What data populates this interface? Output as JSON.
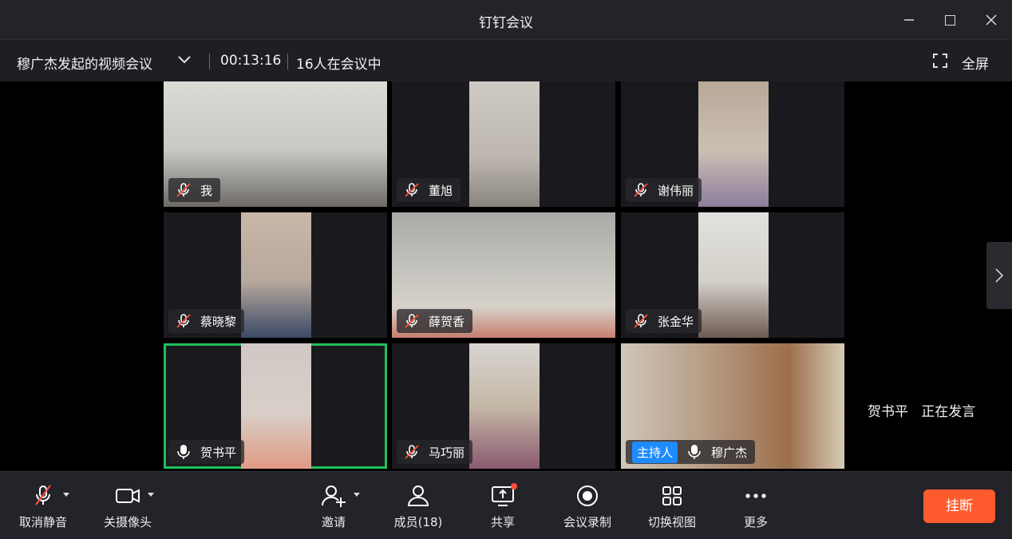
{
  "window": {
    "title": "钉钉会议"
  },
  "info_bar": {
    "meeting_title": "穆广杰发起的视频会议",
    "elapsed_time": "00:13:16",
    "participant_status": "16人在会议中",
    "fullscreen_label": "全屏"
  },
  "participants": [
    {
      "name": "我",
      "muted": true,
      "host": false,
      "speaking": false
    },
    {
      "name": "董旭",
      "muted": true,
      "host": false,
      "speaking": false
    },
    {
      "name": "谢伟丽",
      "muted": true,
      "host": false,
      "speaking": false
    },
    {
      "name": "蔡晓黎",
      "muted": true,
      "host": false,
      "speaking": false
    },
    {
      "name": "薛贺香",
      "muted": true,
      "host": false,
      "speaking": false
    },
    {
      "name": "张金华",
      "muted": true,
      "host": false,
      "speaking": false
    },
    {
      "name": "贺书平",
      "muted": false,
      "host": false,
      "speaking": true
    },
    {
      "name": "马巧丽",
      "muted": true,
      "host": false,
      "speaking": false
    },
    {
      "name": "穆广杰",
      "muted": false,
      "host": true,
      "speaking": false
    }
  ],
  "host_badge": "主持人",
  "speaking_indicator": {
    "name": "贺书平",
    "status": "正在发言"
  },
  "toolbar": {
    "unmute_label": "取消静音",
    "camera_off_label": "关摄像头",
    "invite_label": "邀请",
    "members_label": "成员(18)",
    "share_label": "共享",
    "record_label": "会议录制",
    "switch_view_label": "切换视图",
    "more_label": "更多",
    "hangup_label": "挂断"
  },
  "colors": {
    "active_speaker_border": "#1fbf5c",
    "host_badge": "#1e8bff",
    "hangup": "#ff5b2e",
    "muted_slash": "#ff4d3a"
  }
}
